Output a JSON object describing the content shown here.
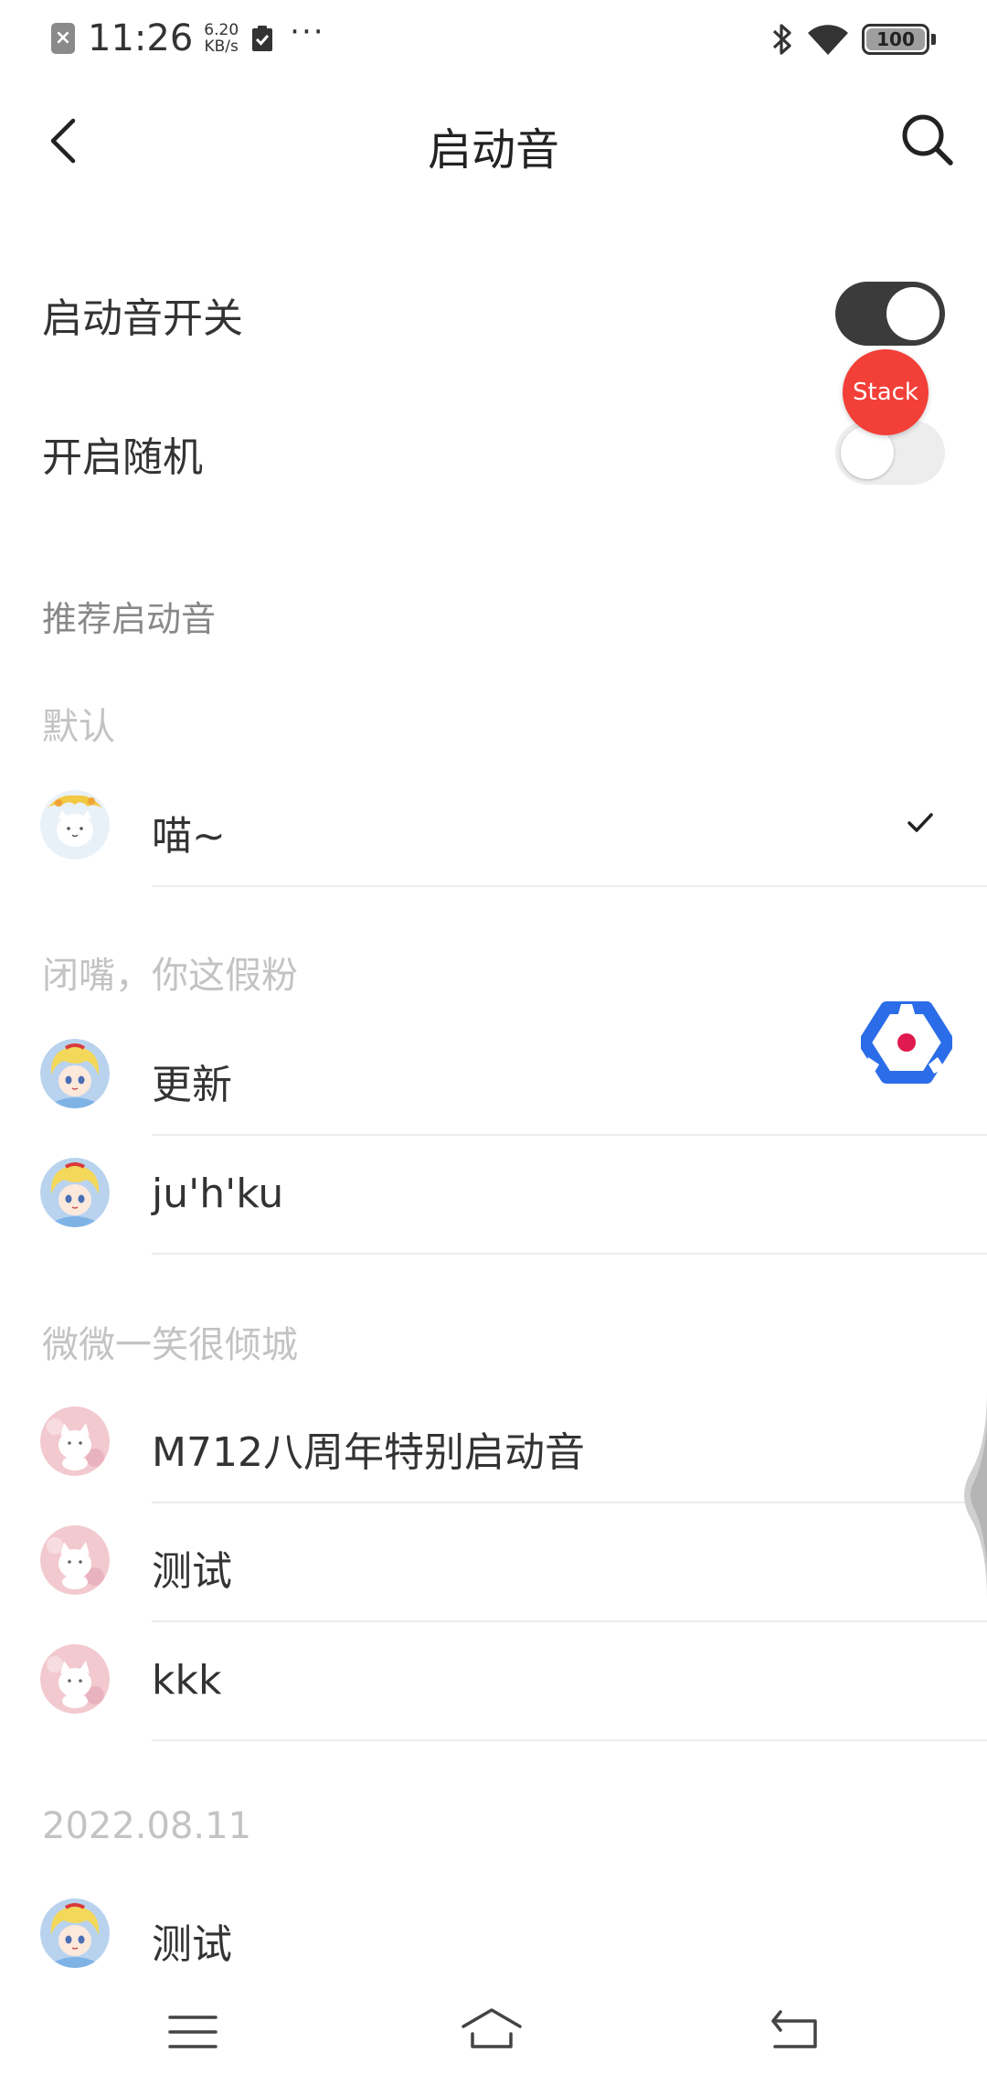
{
  "status_bar": {
    "time": "11:26",
    "speed_value": "6.20",
    "speed_unit": "KB/s",
    "more": "···",
    "battery": "100"
  },
  "header": {
    "title": "启动音"
  },
  "settings": {
    "startup_sound_toggle": {
      "label": "启动音开关",
      "on": true
    },
    "random_toggle": {
      "label": "开启随机",
      "on": false
    }
  },
  "stack_badge": "Stack",
  "recommended": {
    "section_title": "推荐启动音",
    "groups": [
      {
        "title": "默认",
        "items": [
          {
            "label": "喵~",
            "selected": true
          }
        ]
      },
      {
        "title": "闭嘴，你这假粉",
        "items": [
          {
            "label": "更新"
          },
          {
            "label": "ju'h'ku"
          }
        ]
      },
      {
        "title": "微微一笑很倾城",
        "items": [
          {
            "label": "M712八周年特别启动音"
          },
          {
            "label": "测试"
          },
          {
            "label": "kkk"
          }
        ]
      },
      {
        "title": "2022.08.11",
        "items": [
          {
            "label": "测试"
          }
        ]
      }
    ]
  },
  "colors": {
    "toggle_on": "#3b3b3b",
    "toggle_off": "#ededed",
    "stack_badge": "#f23f37",
    "logo_blue": "#2b6de8",
    "logo_dot": "#e0194f"
  },
  "icons": {
    "back": "back-arrow-icon",
    "search": "search-icon",
    "check": "check-icon",
    "nav_menu": "menu-icon",
    "nav_home": "home-icon",
    "nav_back": "return-icon"
  }
}
